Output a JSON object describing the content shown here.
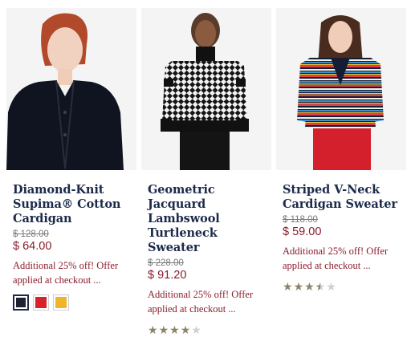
{
  "products": [
    {
      "title": "Diamond-Knit Supima® Cotton Cardigan",
      "original_price": "$ 128.00",
      "sale_price": "$ 64.00",
      "promo": "Additional 25% off! Offer applied at checkout ...",
      "swatches": [
        {
          "name": "navy-swatch",
          "color": "#1c2233",
          "selected": true
        },
        {
          "name": "red-swatch",
          "color": "#d8232c",
          "selected": false
        },
        {
          "name": "yellow-swatch",
          "color": "#efb52a",
          "selected": false
        }
      ]
    },
    {
      "title": "Geometric Jacquard Lambswool Turtleneck Sweater",
      "original_price": "$ 228.00",
      "sale_price": "$ 91.20",
      "promo": "Additional 25% off! Offer applied at checkout ...",
      "rating": 4.0,
      "rating_max": 5
    },
    {
      "title": "Striped V-Neck Cardigan Sweater",
      "original_price": "$ 118.00",
      "sale_price": "$ 59.00",
      "promo": "Additional 25% off! Offer applied at checkout ...",
      "rating": 3.5,
      "rating_max": 5
    }
  ]
}
